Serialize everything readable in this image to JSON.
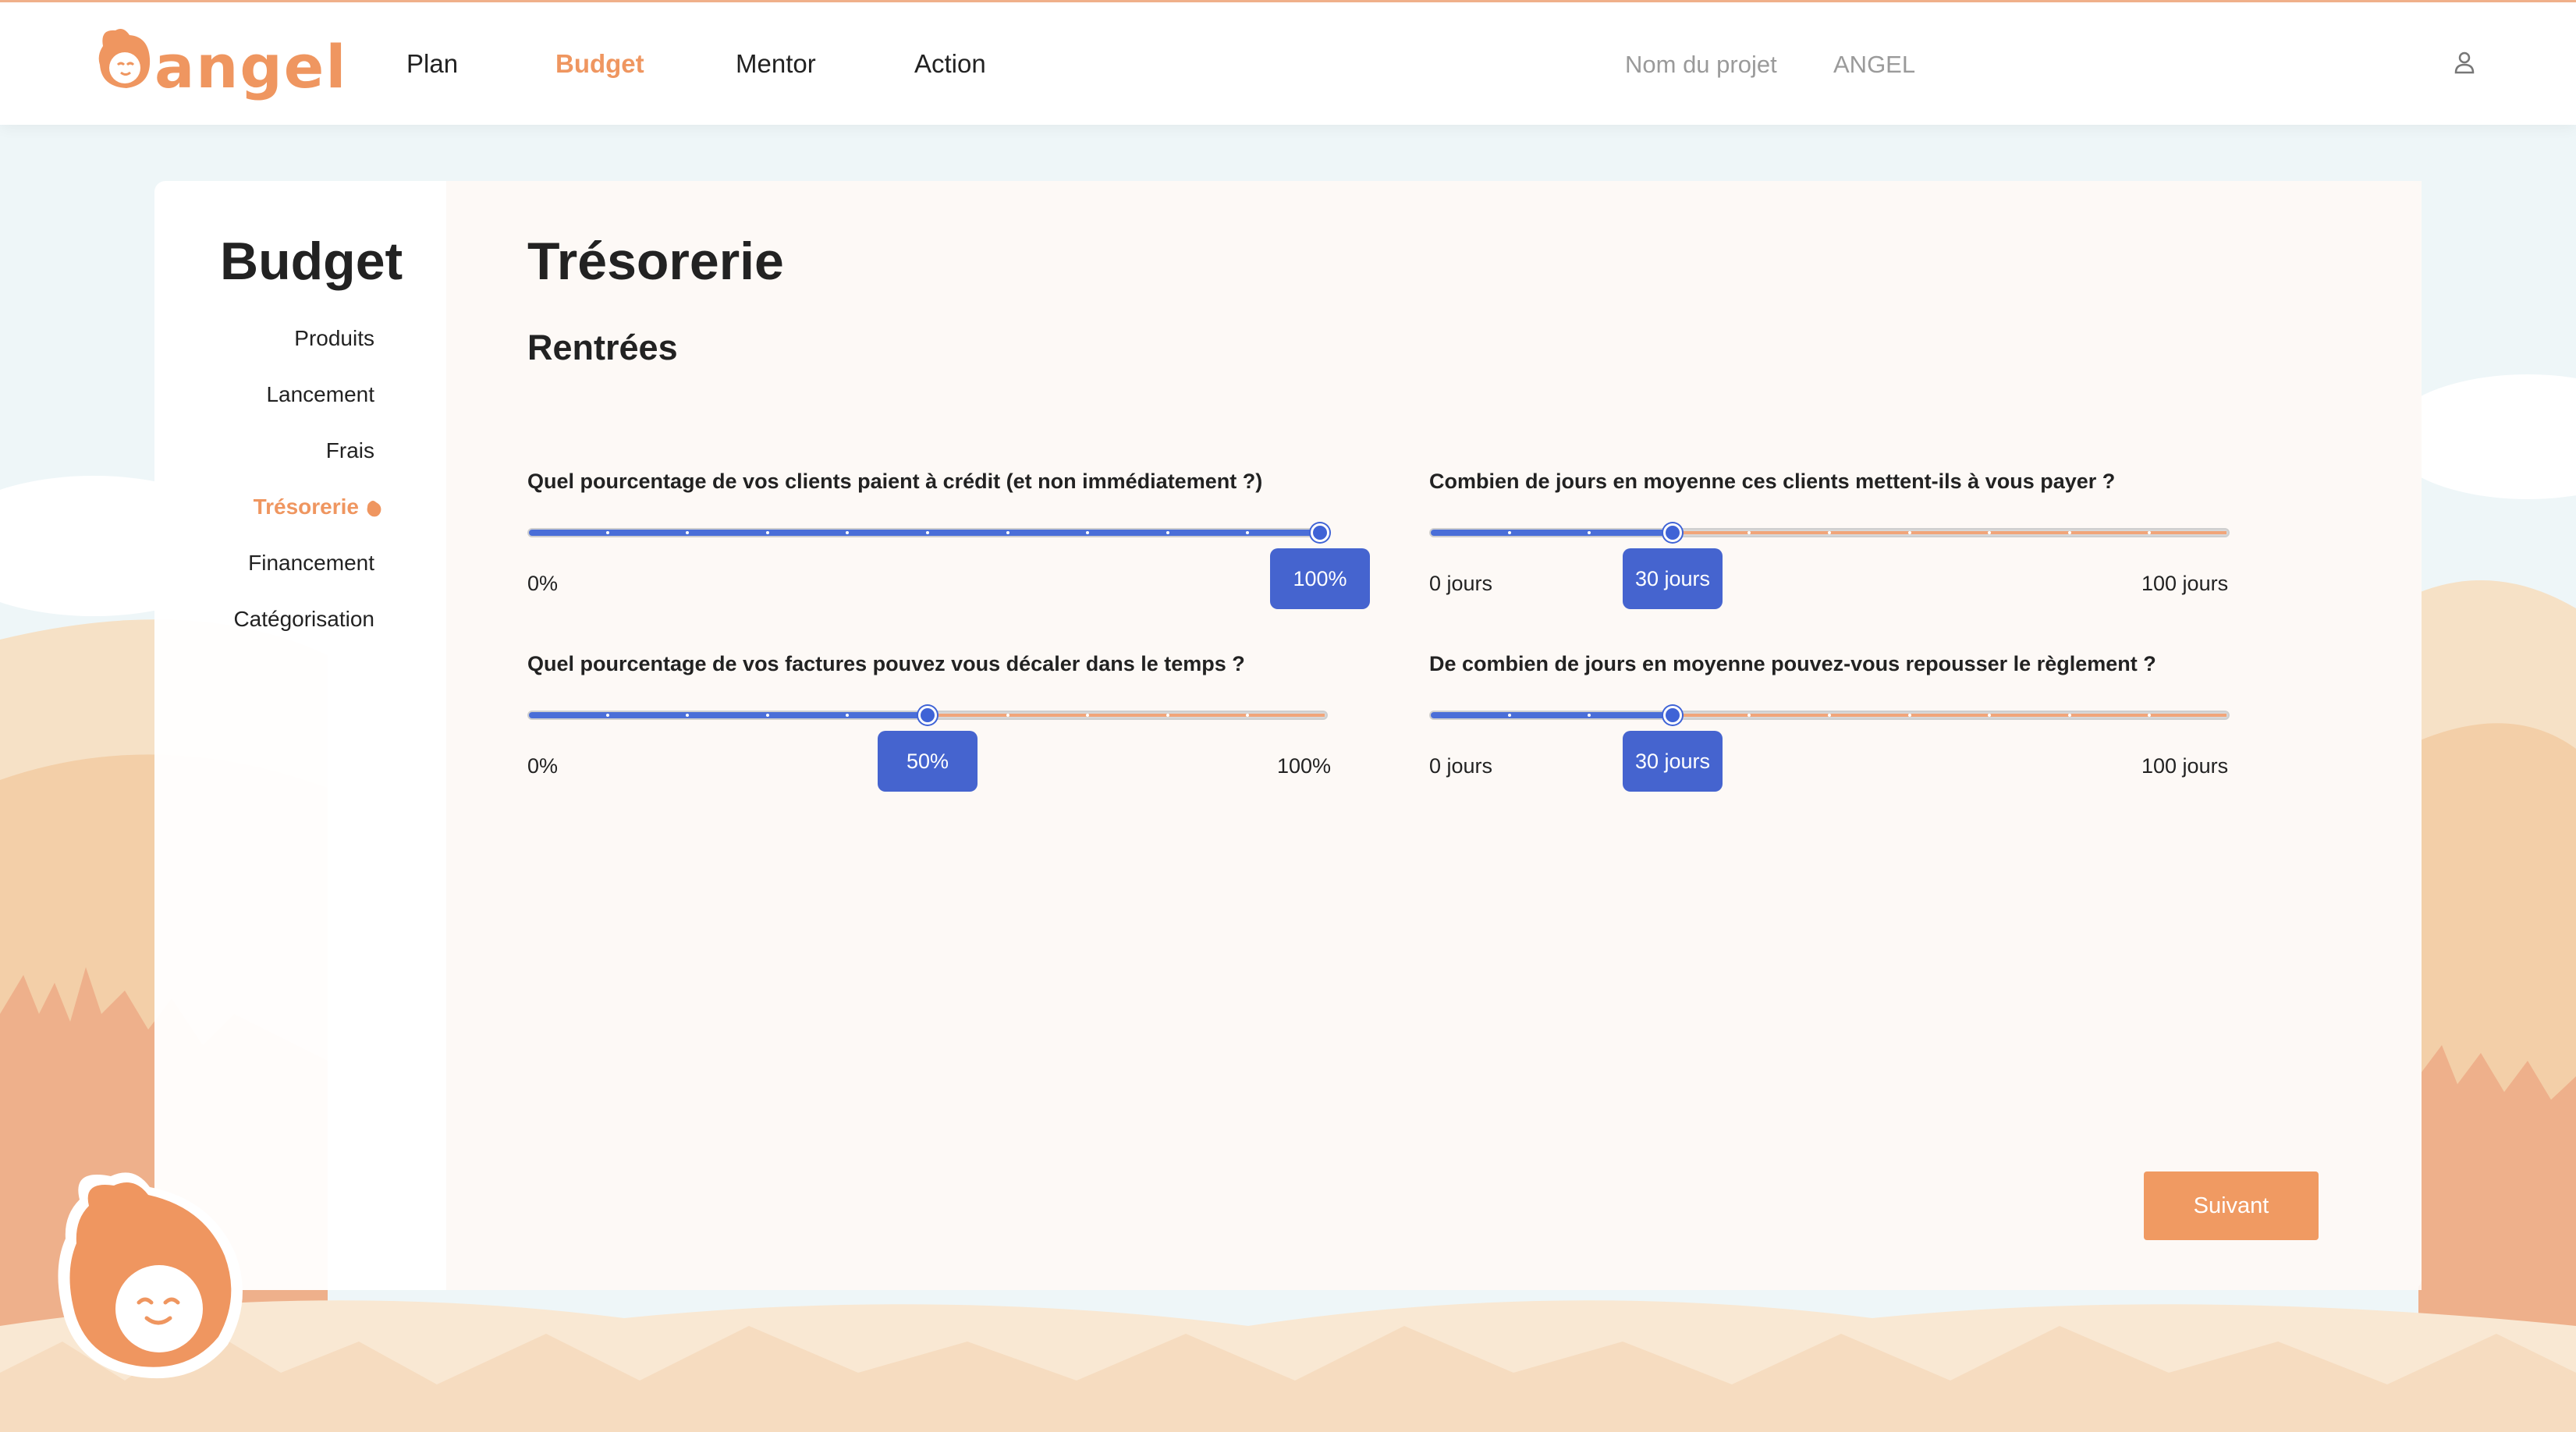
{
  "brand": {
    "logo_text": "angel",
    "accent": "#ef9660",
    "slider_blue": "#4564cf"
  },
  "nav": {
    "links": [
      {
        "label": "Plan",
        "active": false
      },
      {
        "label": "Budget",
        "active": true
      },
      {
        "label": "Mentor",
        "active": false
      },
      {
        "label": "Action",
        "active": false
      }
    ],
    "project_label": "Nom du projet",
    "project_name": "ANGEL"
  },
  "sidebar": {
    "title": "Budget",
    "items": [
      {
        "label": "Produits",
        "active": false
      },
      {
        "label": "Lancement",
        "active": false
      },
      {
        "label": "Frais",
        "active": false
      },
      {
        "label": "Trésorerie",
        "active": true
      },
      {
        "label": "Financement",
        "active": false
      },
      {
        "label": "Catégorisation",
        "active": false
      }
    ]
  },
  "main": {
    "title": "Trésorerie",
    "section": "Rentrées",
    "sliders": [
      {
        "question": "Quel pourcentage de vos clients paient à crédit (et non immédiatement ?)",
        "value": 100,
        "min": 0,
        "max": 100,
        "value_label": "100%",
        "min_label": "0%",
        "max_label": ""
      },
      {
        "question": "Combien de jours en moyenne ces clients mettent-ils à vous payer ?",
        "value": 30,
        "min": 0,
        "max": 100,
        "value_label": "30 jours",
        "min_label": "0 jours",
        "max_label": "100 jours"
      },
      {
        "question": "Quel pourcentage de vos factures pouvez vous décaler dans le temps ?",
        "value": 50,
        "min": 0,
        "max": 100,
        "value_label": "50%",
        "min_label": "0%",
        "max_label": "100%"
      },
      {
        "question": "De combien de jours en moyenne pouvez-vous repousser le règlement ?",
        "value": 30,
        "min": 0,
        "max": 100,
        "value_label": "30 jours",
        "min_label": "0 jours",
        "max_label": "100 jours"
      }
    ],
    "next_button": "Suivant"
  },
  "icons": {
    "user": "user-icon",
    "mascot": "angel-mascot-icon",
    "active_marker": "angel-drop-icon"
  }
}
